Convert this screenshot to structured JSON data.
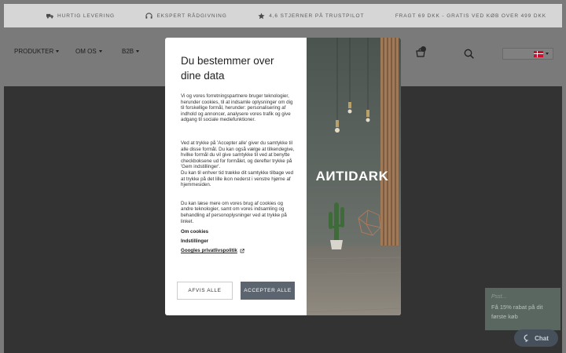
{
  "topbar": {
    "items": [
      {
        "icon": "truck-icon",
        "text": "HURTIG LEVERING"
      },
      {
        "icon": "headset-icon",
        "text": "EKSPERT RÅDGIVNING"
      },
      {
        "icon": "star-icon",
        "text": "4,6 STJERNER PÅ TRUSTPILOT"
      },
      {
        "text": "FRAGT 69 DKK - GRATIS VED KØB OVER 499 DKK"
      }
    ]
  },
  "nav": {
    "items": [
      {
        "label": "PRODUKTER"
      },
      {
        "label": "OM OS"
      },
      {
        "label": "B2B"
      }
    ],
    "cart_count": "0",
    "language": "Dansk"
  },
  "modal": {
    "title": "Du bestemmer over dine data",
    "paragraphs": [
      "Vi og vores forretningspartnere bruger teknologier, herunder cookies, til at indsamle oplysninger om dig til forskellige formål, herunder: personalisering af indhold og annoncer, analysere vores trafik og give adgang til sociale mediefunktioner.",
      "Ved at trykke på 'Accepter alle' giver du samtykke til alle disse formål. Du kan også vælge at tilkendegive, hvilke formål du vil give samtykke til ved at benytte checkboksene ud for formålet, og derefter trykke på 'Gem indstillinger'.",
      "Du kan til enhver tid trække dit samtykke tilbage ved at trykke på det lille ikon nederst i venstre hjørne af hjemmesiden.",
      "Du kan læse mere om vores brug af cookies og andre teknologier, samt om vores indsamling og behandling af personoplysninger ved at trykke på linket."
    ],
    "links": {
      "cookies": "Om cookies",
      "settings": "Indstillinger",
      "google": "Googles privatlivspolitik"
    },
    "reject_label": "AFVIS ALLE",
    "accept_label": "ACCEPTER ALLE",
    "brand": "AИTIDARK"
  },
  "chat": {
    "hint": "Psst...",
    "message": "Få 15% rabat på dit første køb",
    "button_label": "Chat"
  },
  "colors": {
    "overlay": "#7a7a7a",
    "hero": "#333333",
    "accept_button": "#5c656f",
    "chat_widget": "#45505a"
  }
}
